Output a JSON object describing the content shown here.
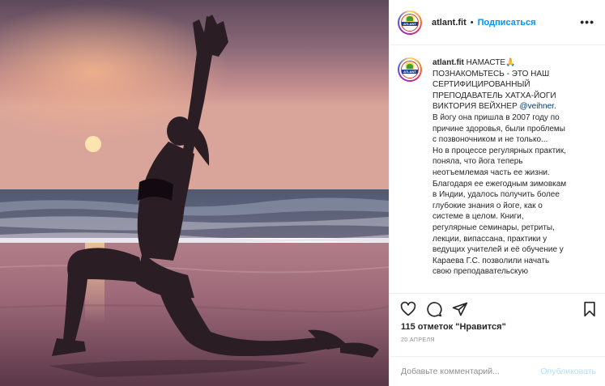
{
  "post": {
    "username": "atlant.fit",
    "dot": "•",
    "follow_label": "Подписаться",
    "more_label": "•••",
    "avatar_text": "ATLANT"
  },
  "caption": {
    "username": "atlant.fit",
    "lines": [
      "НАМАСТЕ🙏",
      "ПОЗНАКОМЬТЕСЬ - ЭТО НАШ",
      "СЕРТИФИЦИРОВАННЫЙ",
      "ПРЕПОДАВАТЕЛЬ ХАТХА-ЙОГИ",
      "ВИКТОРИЯ ВЕЙХНЕР"
    ],
    "mention": "@veihner",
    "mention_suffix": ".",
    "body_lines": [
      "В йогу она пришла в 2007 году по",
      "причине здоровья, были проблемы",
      "с позвоночником и не только...",
      "Но в процессе регулярных практик,",
      "поняла, что йога теперь",
      "неотъемлемая часть ее жизни.",
      "Благодаря ее ежегодным зимовкам",
      "в Индии, удалось получить более",
      "глубокие знания о йоге, как о",
      "системе в целом. Книги,",
      "регулярные семинары, ретриты,",
      "лекции, випассана, практики у",
      "ведущих учителей и её обучение у",
      "Караева Г.С. позволили начать",
      "свою преподавательскую"
    ]
  },
  "actions": {
    "icons": [
      "heart-icon",
      "comment-icon",
      "share-icon",
      "bookmark-icon"
    ]
  },
  "likes_text": "115 отметок \"Нравится\"",
  "date_text": "20 АПРЕЛЯ",
  "comment": {
    "placeholder": "Добавьте комментарий...",
    "publish_label": "Опубликовать"
  },
  "colors": {
    "accent": "#0095f6",
    "publish_disabled": "#b2dffc",
    "mention": "#00376b"
  }
}
